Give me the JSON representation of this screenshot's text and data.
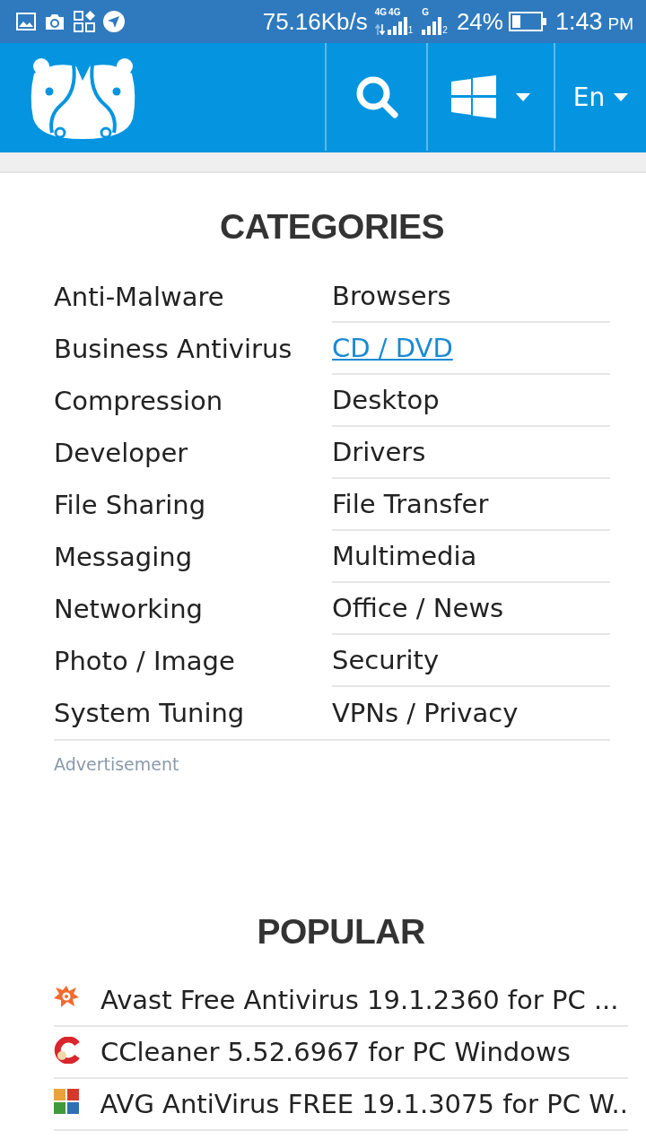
{
  "status_bar": {
    "speed": "75.16Kb/s",
    "sims": [
      {
        "tags": [
          "4G",
          "4G"
        ],
        "data_arrows": true,
        "number": "1"
      },
      {
        "tags": [
          "G"
        ],
        "data_arrows": false,
        "number": "2"
      }
    ],
    "battery": "24%",
    "time": "1:43",
    "meridiem": "PM"
  },
  "header": {
    "language": "En"
  },
  "categories": {
    "title": "CATEGORIES",
    "items": [
      {
        "label": "Anti-Malware",
        "highlighted": false
      },
      {
        "label": "Browsers",
        "highlighted": false
      },
      {
        "label": "Business Antivirus",
        "highlighted": false
      },
      {
        "label": "CD / DVD",
        "highlighted": true
      },
      {
        "label": "Compression",
        "highlighted": false
      },
      {
        "label": "Desktop",
        "highlighted": false
      },
      {
        "label": "Developer",
        "highlighted": false
      },
      {
        "label": "Drivers",
        "highlighted": false
      },
      {
        "label": "File Sharing",
        "highlighted": false
      },
      {
        "label": "File Transfer",
        "highlighted": false
      },
      {
        "label": "Messaging",
        "highlighted": false
      },
      {
        "label": "Multimedia",
        "highlighted": false
      },
      {
        "label": "Networking",
        "highlighted": false
      },
      {
        "label": "Office / News",
        "highlighted": false
      },
      {
        "label": "Photo / Image",
        "highlighted": false
      },
      {
        "label": "Security",
        "highlighted": false
      },
      {
        "label": "System Tuning",
        "highlighted": false
      },
      {
        "label": "VPNs / Privacy",
        "highlighted": false
      }
    ]
  },
  "advertisement": "Advertisement",
  "popular": {
    "title": "POPULAR",
    "items": [
      {
        "kind": "splat",
        "name": "Avast Free Antivirus 19.1.2360 for PC ..."
      },
      {
        "kind": "ring",
        "name": "CCleaner 5.52.6967 for PC Windows"
      },
      {
        "kind": "tiles",
        "name": "AVG AntiVirus FREE 19.1.3075 for PC W.."
      }
    ]
  }
}
